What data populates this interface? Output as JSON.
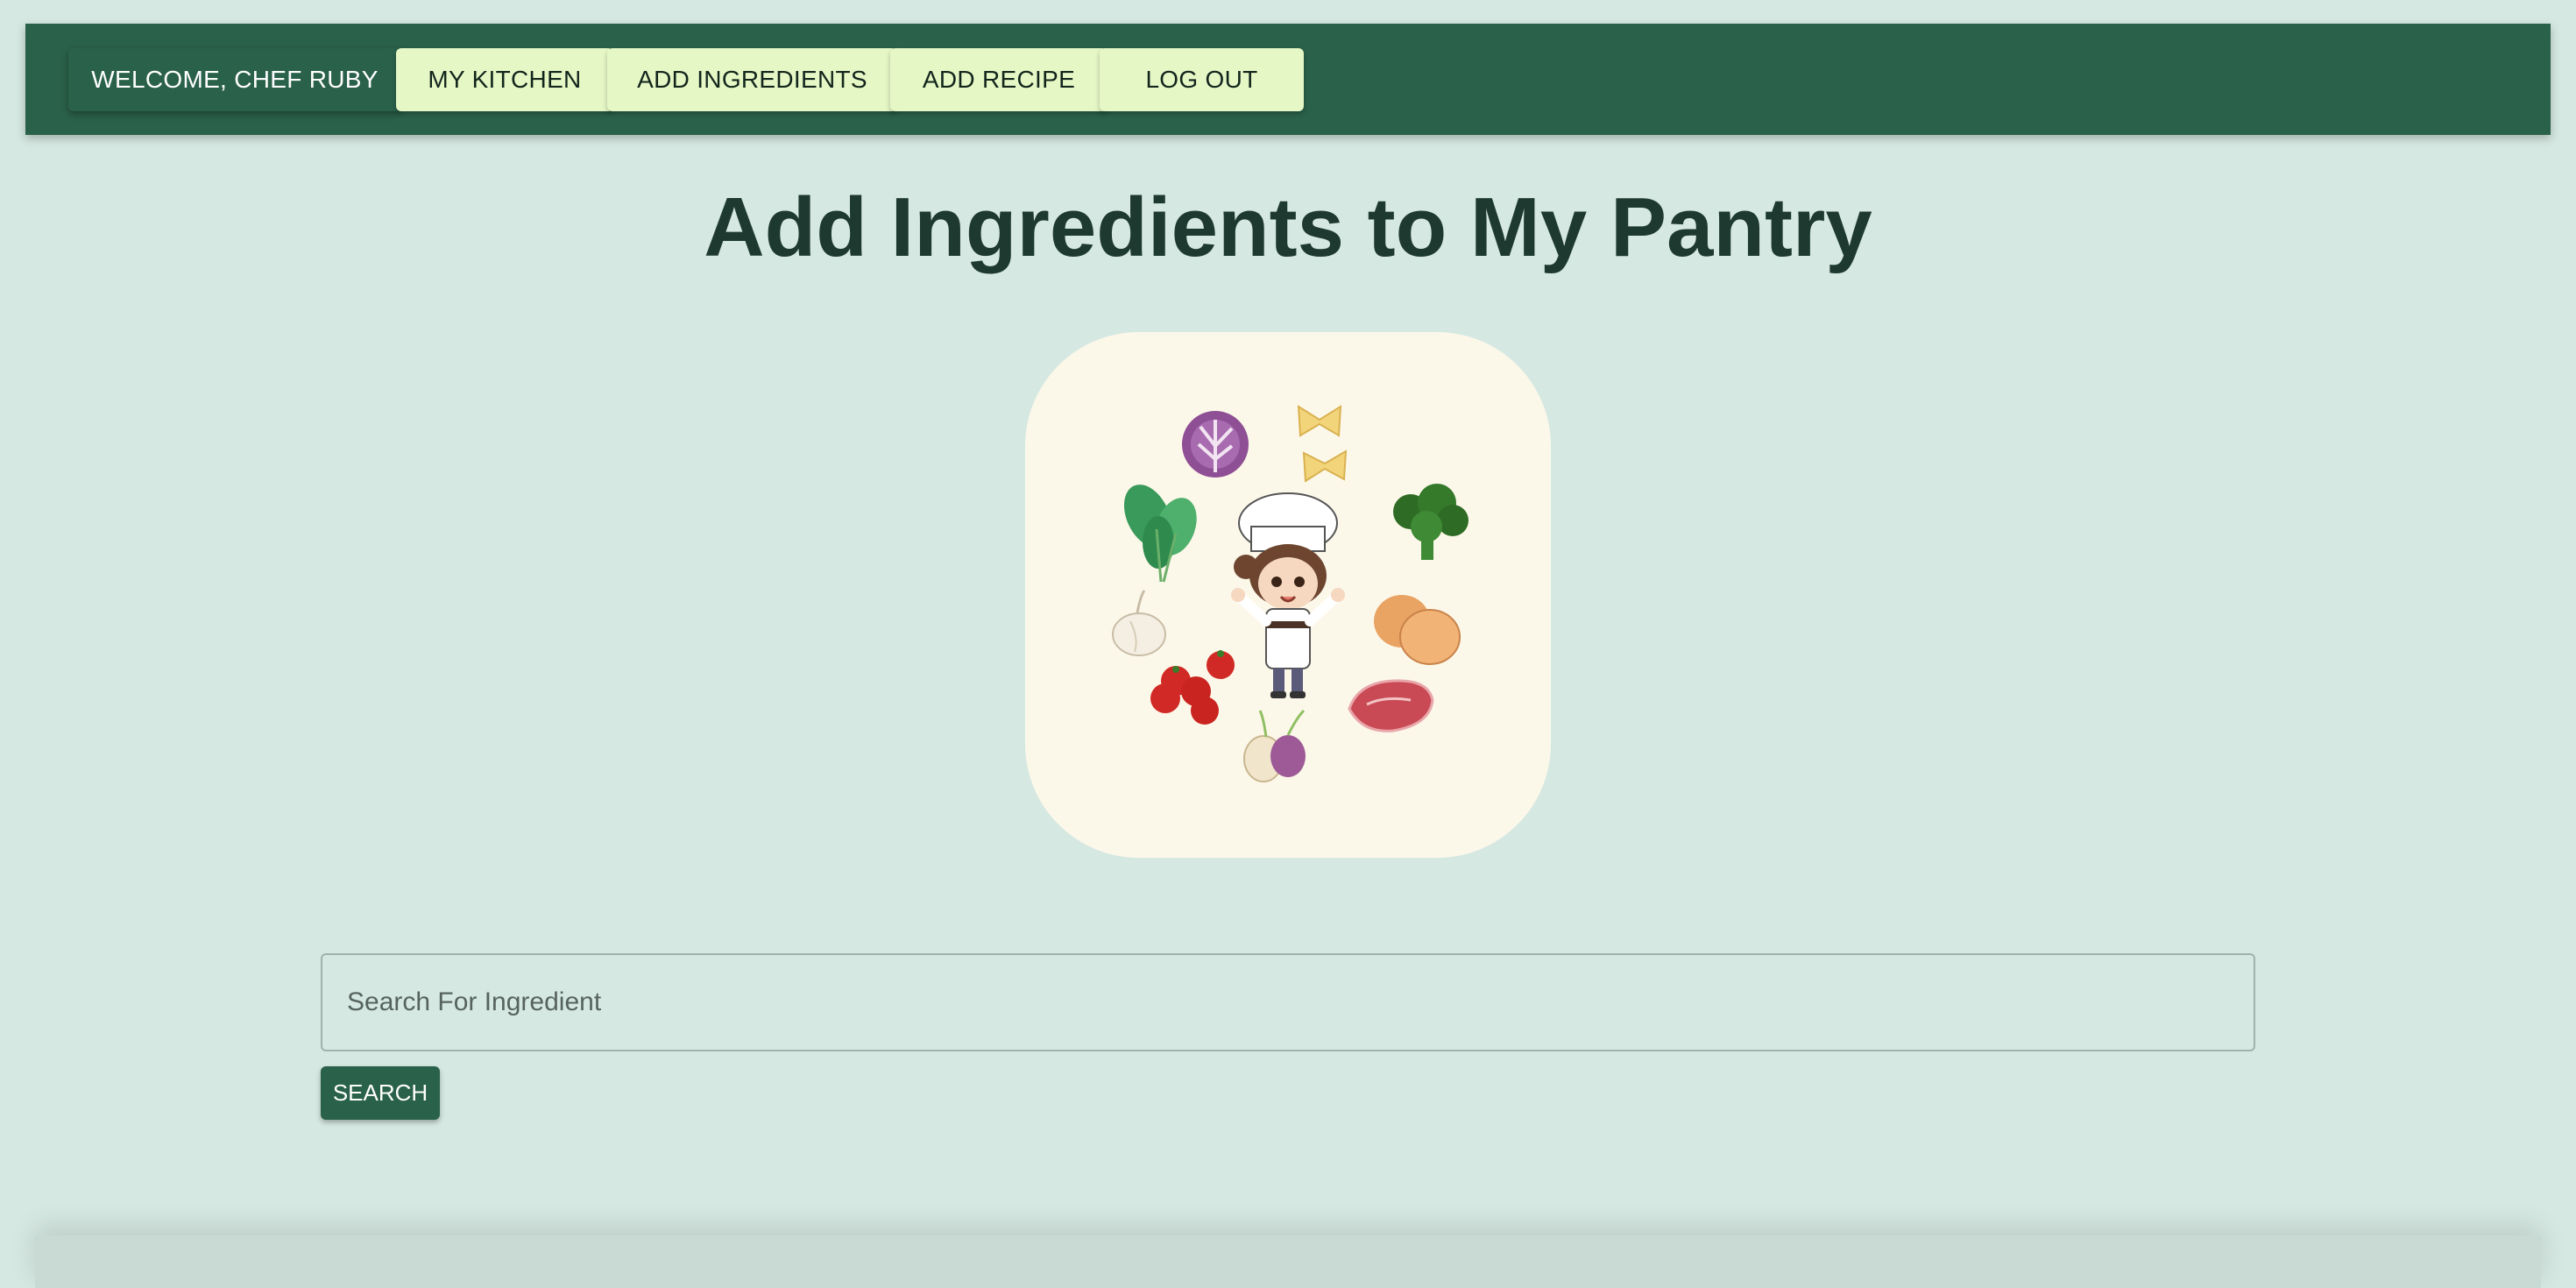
{
  "nav": {
    "welcome": "WELCOME, CHEF RUBY",
    "my_kitchen": "MY KITCHEN",
    "add_ingredients": "ADD INGREDIENTS",
    "add_recipe": "ADD RECIPE",
    "log_out": "LOG OUT"
  },
  "main": {
    "title": "Add Ingredients to My Pantry",
    "hero_image": "chef-with-ingredients-illustration"
  },
  "search": {
    "placeholder": "Search For Ingredient",
    "value": "",
    "button_label": "SEARCH"
  },
  "colors": {
    "background": "#d6e8e2",
    "nav_green": "#2a614a",
    "nav_button_light": "#e6f7c6",
    "hero_card": "#fcf8e9",
    "title_text": "#1e3a30"
  }
}
